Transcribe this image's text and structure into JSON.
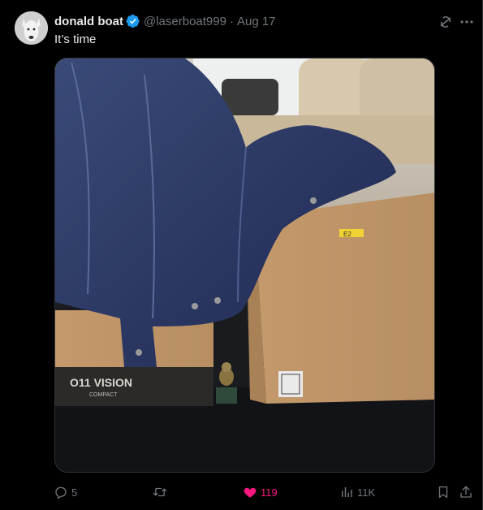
{
  "tweet": {
    "author_name": "donald boat",
    "handle": "@laserboat999",
    "separator": "·",
    "date": "Aug 17",
    "text": "It’s time",
    "verified": true
  },
  "media": {
    "box_left_brand": "O11 VISION",
    "box_left_sub": "COMPACT",
    "box_right_label": "E2"
  },
  "actions": {
    "replies": "5",
    "retweets": "",
    "likes": "119",
    "views": "11K"
  },
  "colors": {
    "background": "#000000",
    "primary_text": "#e7e9ea",
    "secondary_text": "#71767b",
    "like_active": "#f91880",
    "verified_badge": "#1d9bf0"
  },
  "icons": [
    "avatar",
    "verified-badge-icon",
    "grok-icon",
    "more-icon",
    "reply-icon",
    "retweet-icon",
    "heart-icon",
    "views-icon",
    "bookmark-icon",
    "share-icon"
  ]
}
